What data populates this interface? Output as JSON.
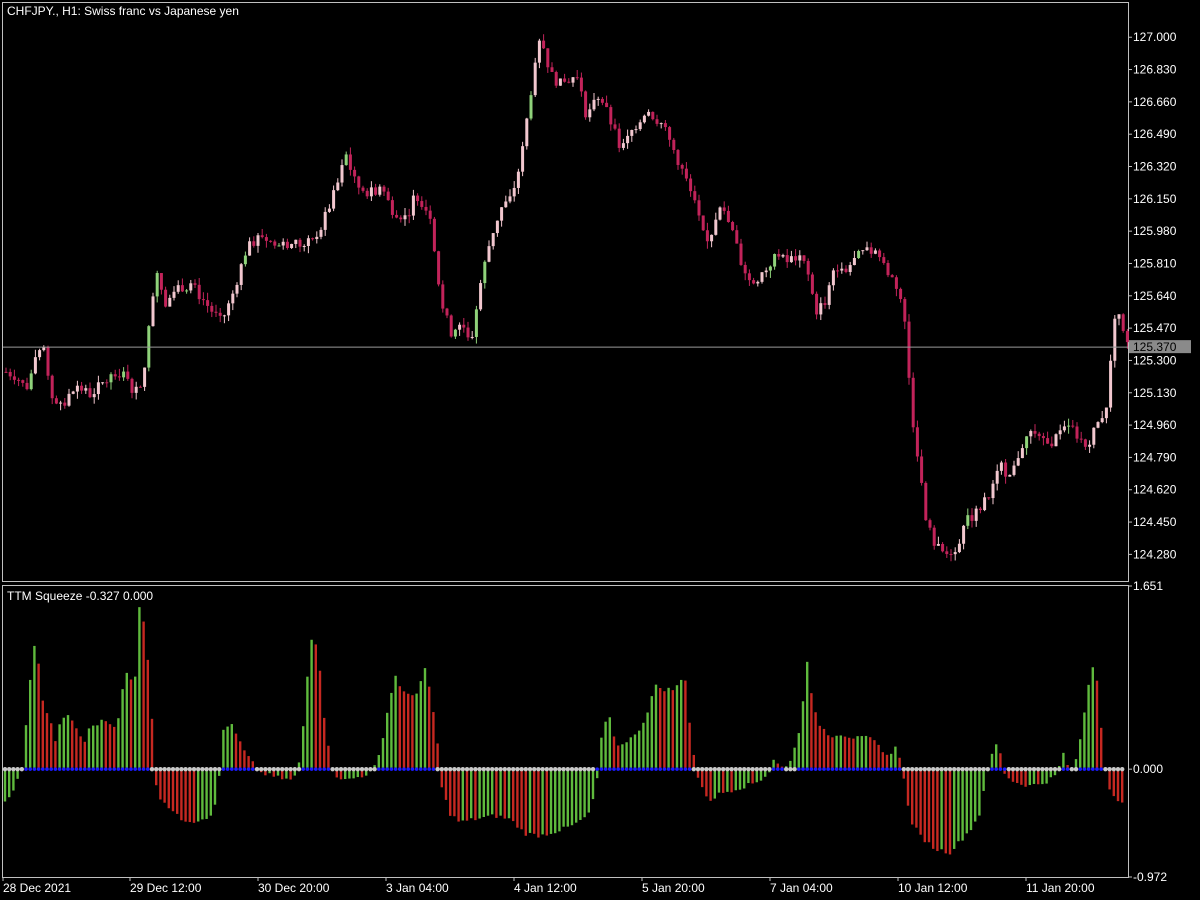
{
  "chart_data": [
    {
      "type": "candlestick",
      "title": "CHFJPY., H1:  Swiss franc vs Japanese yen",
      "symbol": "CHFJPY.",
      "timeframe": "H1",
      "description": "Swiss franc vs Japanese yen",
      "ylim": [
        124.14,
        127.18
      ],
      "y_ticks": [
        "127.000",
        "126.830",
        "126.660",
        "126.490",
        "126.320",
        "126.150",
        "125.980",
        "125.810",
        "125.640",
        "125.470",
        "125.300",
        "125.130",
        "124.960",
        "124.790",
        "124.620",
        "124.450",
        "124.280"
      ],
      "current_price": 125.37,
      "current_price_label": "125.370",
      "x_ticks": [
        "28 Dec 2021",
        "29 Dec 12:00",
        "30 Dec 20:00",
        "3 Jan 04:00",
        "4 Jan 12:00",
        "5 Jan 20:00",
        "7 Jan 04:00",
        "10 Jan 12:00",
        "11 Jan 20:00"
      ],
      "close_path": [
        [
          0,
          125.24
        ],
        [
          10,
          125.22
        ],
        [
          20,
          125.15
        ],
        [
          30,
          125.3
        ],
        [
          38,
          125.36
        ],
        [
          45,
          125.12
        ],
        [
          55,
          125.05
        ],
        [
          70,
          125.16
        ],
        [
          85,
          125.12
        ],
        [
          100,
          125.2
        ],
        [
          115,
          125.24
        ],
        [
          125,
          125.16
        ],
        [
          135,
          125.14
        ],
        [
          145,
          125.55
        ],
        [
          150,
          125.8
        ],
        [
          160,
          125.6
        ],
        [
          170,
          125.68
        ],
        [
          185,
          125.7
        ],
        [
          200,
          125.6
        ],
        [
          215,
          125.5
        ],
        [
          225,
          125.62
        ],
        [
          240,
          125.88
        ],
        [
          255,
          125.96
        ],
        [
          270,
          125.9
        ],
        [
          285,
          125.92
        ],
        [
          300,
          125.9
        ],
        [
          315,
          126.0
        ],
        [
          330,
          126.2
        ],
        [
          340,
          126.38
        ],
        [
          350,
          126.22
        ],
        [
          365,
          126.18
        ],
        [
          375,
          126.22
        ],
        [
          385,
          126.1
        ],
        [
          400,
          126.05
        ],
        [
          410,
          126.18
        ],
        [
          425,
          126.06
        ],
        [
          435,
          125.6
        ],
        [
          445,
          125.45
        ],
        [
          455,
          125.5
        ],
        [
          465,
          125.4
        ],
        [
          475,
          125.72
        ],
        [
          485,
          125.95
        ],
        [
          495,
          126.1
        ],
        [
          505,
          126.15
        ],
        [
          515,
          126.35
        ],
        [
          525,
          126.72
        ],
        [
          535,
          127.0
        ],
        [
          545,
          126.8
        ],
        [
          555,
          126.75
        ],
        [
          570,
          126.8
        ],
        [
          580,
          126.6
        ],
        [
          595,
          126.68
        ],
        [
          605,
          126.55
        ],
        [
          615,
          126.4
        ],
        [
          625,
          126.5
        ],
        [
          640,
          126.62
        ],
        [
          655,
          126.55
        ],
        [
          670,
          126.38
        ],
        [
          680,
          126.25
        ],
        [
          690,
          126.1
        ],
        [
          700,
          125.9
        ],
        [
          715,
          126.1
        ],
        [
          725,
          126.0
        ],
        [
          735,
          125.82
        ],
        [
          745,
          125.7
        ],
        [
          760,
          125.78
        ],
        [
          770,
          125.85
        ],
        [
          780,
          125.82
        ],
        [
          790,
          125.84
        ],
        [
          800,
          125.8
        ],
        [
          810,
          125.56
        ],
        [
          820,
          125.62
        ],
        [
          830,
          125.8
        ],
        [
          840,
          125.78
        ],
        [
          855,
          125.86
        ],
        [
          870,
          125.88
        ],
        [
          880,
          125.78
        ],
        [
          890,
          125.7
        ],
        [
          895,
          125.62
        ],
        [
          900,
          125.45
        ],
        [
          905,
          125.05
        ],
        [
          912,
          124.8
        ],
        [
          920,
          124.45
        ],
        [
          930,
          124.32
        ],
        [
          940,
          124.28
        ],
        [
          950,
          124.32
        ],
        [
          960,
          124.45
        ],
        [
          970,
          124.5
        ],
        [
          985,
          124.6
        ],
        [
          995,
          124.75
        ],
        [
          1005,
          124.68
        ],
        [
          1015,
          124.85
        ],
        [
          1025,
          124.92
        ],
        [
          1040,
          124.85
        ],
        [
          1055,
          124.92
        ],
        [
          1065,
          124.95
        ],
        [
          1080,
          124.85
        ],
        [
          1090,
          124.95
        ],
        [
          1100,
          125.05
        ],
        [
          1105,
          125.3
        ],
        [
          1110,
          125.62
        ],
        [
          1118,
          125.42
        ],
        [
          1125,
          125.37
        ]
      ]
    },
    {
      "type": "histogram",
      "title": "TTM Squeeze -0.327 0.000",
      "indicator": "TTM Squeeze",
      "last_value": -0.327,
      "signal_value": 0.0,
      "ylim": [
        -0.972,
        1.651
      ],
      "y_ticks": [
        "1.651",
        "0.000",
        "-0.972"
      ],
      "colors": {
        "rising": "#5fba3d",
        "falling": "#c62821",
        "squeeze_on": "#1a1aff",
        "squeeze_off": "#c8c8c8"
      },
      "hist_path": [
        [
          0,
          -0.3
        ],
        [
          5,
          -0.25
        ],
        [
          10,
          -0.15
        ],
        [
          15,
          -0.05
        ],
        [
          18,
          0.05
        ],
        [
          22,
          0.5
        ],
        [
          28,
          1.1
        ],
        [
          32,
          1.1
        ],
        [
          36,
          0.7
        ],
        [
          40,
          0.55
        ],
        [
          45,
          0.45
        ],
        [
          50,
          0.25
        ],
        [
          55,
          0.4
        ],
        [
          60,
          0.5
        ],
        [
          65,
          0.45
        ],
        [
          70,
          0.4
        ],
        [
          75,
          0.3
        ],
        [
          80,
          0.25
        ],
        [
          85,
          0.38
        ],
        [
          95,
          0.42
        ],
        [
          100,
          0.45
        ],
        [
          108,
          0.38
        ],
        [
          115,
          0.5
        ],
        [
          120,
          0.9
        ],
        [
          125,
          0.8
        ],
        [
          130,
          0.8
        ],
        [
          135,
          1.57
        ],
        [
          140,
          1.25
        ],
        [
          145,
          0.8
        ],
        [
          150,
          -0.1
        ],
        [
          155,
          -0.25
        ],
        [
          165,
          -0.35
        ],
        [
          175,
          -0.45
        ],
        [
          190,
          -0.47
        ],
        [
          205,
          -0.42
        ],
        [
          212,
          -0.3
        ],
        [
          218,
          0.35
        ],
        [
          225,
          0.42
        ],
        [
          232,
          0.3
        ],
        [
          240,
          0.15
        ],
        [
          248,
          0.05
        ],
        [
          255,
          -0.03
        ],
        [
          270,
          -0.07
        ],
        [
          285,
          -0.1
        ],
        [
          292,
          -0.05
        ],
        [
          296,
          0.15
        ],
        [
          302,
          0.8
        ],
        [
          308,
          1.3
        ],
        [
          315,
          0.9
        ],
        [
          320,
          0.4
        ],
        [
          325,
          0.1
        ],
        [
          330,
          -0.05
        ],
        [
          340,
          -0.1
        ],
        [
          350,
          -0.08
        ],
        [
          360,
          -0.05
        ],
        [
          368,
          -0.02
        ],
        [
          375,
          0.15
        ],
        [
          382,
          0.5
        ],
        [
          390,
          0.85
        ],
        [
          398,
          0.7
        ],
        [
          405,
          0.65
        ],
        [
          412,
          0.7
        ],
        [
          420,
          0.9
        ],
        [
          426,
          0.65
        ],
        [
          432,
          0.3
        ],
        [
          436,
          -0.15
        ],
        [
          445,
          -0.4
        ],
        [
          455,
          -0.48
        ],
        [
          470,
          -0.45
        ],
        [
          490,
          -0.42
        ],
        [
          505,
          -0.45
        ],
        [
          520,
          -0.58
        ],
        [
          535,
          -0.6
        ],
        [
          555,
          -0.55
        ],
        [
          570,
          -0.5
        ],
        [
          585,
          -0.4
        ],
        [
          592,
          -0.1
        ],
        [
          598,
          0.4
        ],
        [
          605,
          0.45
        ],
        [
          612,
          0.2
        ],
        [
          620,
          0.25
        ],
        [
          630,
          0.3
        ],
        [
          640,
          0.45
        ],
        [
          650,
          0.75
        ],
        [
          660,
          0.72
        ],
        [
          670,
          0.72
        ],
        [
          680,
          0.85
        ],
        [
          686,
          0.3
        ],
        [
          690,
          0.05
        ],
        [
          695,
          -0.15
        ],
        [
          705,
          -0.28
        ],
        [
          715,
          -0.22
        ],
        [
          730,
          -0.18
        ],
        [
          745,
          -0.14
        ],
        [
          755,
          -0.1
        ],
        [
          765,
          -0.02
        ],
        [
          768,
          0.1
        ],
        [
          772,
          0.05
        ],
        [
          780,
          0.0
        ],
        [
          786,
          0.1
        ],
        [
          795,
          0.35
        ],
        [
          802,
          1.0
        ],
        [
          808,
          0.55
        ],
        [
          815,
          0.4
        ],
        [
          825,
          0.3
        ],
        [
          835,
          0.32
        ],
        [
          850,
          0.28
        ],
        [
          865,
          0.28
        ],
        [
          875,
          0.2
        ],
        [
          885,
          0.1
        ],
        [
          892,
          0.25
        ],
        [
          898,
          -0.05
        ],
        [
          905,
          -0.45
        ],
        [
          915,
          -0.6
        ],
        [
          930,
          -0.72
        ],
        [
          945,
          -0.75
        ],
        [
          955,
          -0.65
        ],
        [
          965,
          -0.55
        ],
        [
          975,
          -0.4
        ],
        [
          980,
          -0.1
        ],
        [
          985,
          0.05
        ],
        [
          990,
          0.25
        ],
        [
          995,
          0.15
        ],
        [
          1000,
          -0.05
        ],
        [
          1010,
          -0.12
        ],
        [
          1025,
          -0.15
        ],
        [
          1040,
          -0.12
        ],
        [
          1052,
          -0.05
        ],
        [
          1058,
          0.15
        ],
        [
          1062,
          0.05
        ],
        [
          1068,
          -0.02
        ],
        [
          1075,
          0.25
        ],
        [
          1080,
          0.55
        ],
        [
          1085,
          0.85
        ],
        [
          1090,
          1.0
        ],
        [
          1095,
          0.5
        ],
        [
          1100,
          0.05
        ],
        [
          1105,
          -0.2
        ],
        [
          1112,
          -0.3
        ],
        [
          1120,
          -0.32
        ]
      ],
      "squeeze_on_ranges": [
        [
          20,
          145
        ],
        [
          218,
          250
        ],
        [
          298,
          325
        ],
        [
          370,
          430
        ],
        [
          590,
          688
        ],
        [
          765,
          780
        ],
        [
          790,
          898
        ],
        [
          985,
          1000
        ],
        [
          1058,
          1065
        ],
        [
          1075,
          1100
        ]
      ]
    }
  ]
}
